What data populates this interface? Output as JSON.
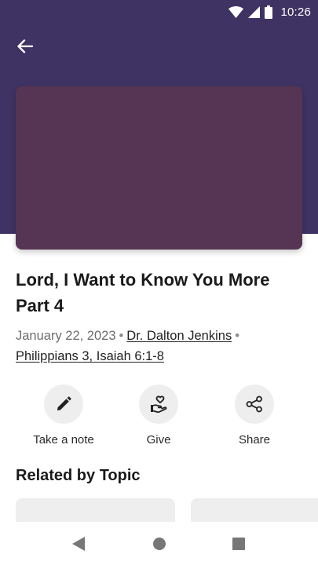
{
  "status_bar": {
    "time": "10:26",
    "icons": [
      "wifi-icon",
      "signal-icon",
      "battery-icon"
    ]
  },
  "header": {
    "back_icon": "arrow-left-icon",
    "background_color": "#3f3363",
    "artwork_color": "#553553"
  },
  "sermon": {
    "title": "Lord, I Want to Know You More Part 4",
    "date": "January 22, 2023",
    "separator": "•",
    "speaker": "Dr. Dalton Jenkins",
    "scripture": "Philippians 3, Isaiah 6:1-8"
  },
  "actions": [
    {
      "label": "Take a note",
      "icon": "pencil-icon"
    },
    {
      "label": "Give",
      "icon": "give-heart-hand-icon"
    },
    {
      "label": "Share",
      "icon": "share-icon"
    }
  ],
  "related": {
    "heading": "Related by Topic"
  },
  "nav_bar": {
    "buttons": [
      "back-triangle-icon",
      "home-circle-icon",
      "recents-square-icon"
    ]
  }
}
